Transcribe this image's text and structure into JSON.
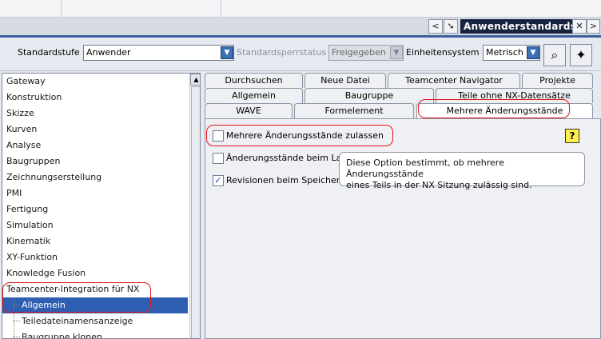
{
  "header": {
    "title": "Anwenderstandards",
    "nav_prev": "<",
    "nav_next": ">"
  },
  "toolbar": {
    "standard_level_label": "Standardstufe",
    "standard_level_value": "Anwender",
    "lock_status_label": "Standardsperrstatus",
    "lock_status_value": "Freigegeben",
    "unit_system_label": "Einheitensystem",
    "unit_system_value": "Metrisch"
  },
  "sidebar": {
    "items": [
      {
        "label": "Gateway"
      },
      {
        "label": "Konstruktion"
      },
      {
        "label": "Skizze"
      },
      {
        "label": "Kurven"
      },
      {
        "label": "Analyse"
      },
      {
        "label": "Baugruppen"
      },
      {
        "label": "Zeichnungserstellung"
      },
      {
        "label": "PMI"
      },
      {
        "label": "Fertigung"
      },
      {
        "label": "Simulation"
      },
      {
        "label": "Kinematik"
      },
      {
        "label": "XY-Funktion"
      },
      {
        "label": "Knowledge Fusion"
      },
      {
        "label": "Teamcenter-Integration für NX"
      },
      {
        "label": "Allgemein"
      },
      {
        "label": "Teiledateinamensanzeige"
      },
      {
        "label": "Baugruppe klonen"
      }
    ]
  },
  "tabs": {
    "row1": [
      "Durchsuchen",
      "Neue Datei",
      "Teamcenter Navigator",
      "Projekte"
    ],
    "row2": [
      "Allgemein",
      "Baugruppe",
      "Teile ohne NX-Datensätze"
    ],
    "row3": [
      "WAVE",
      "Formelement",
      "Mehrere Änderungsstände"
    ]
  },
  "options": [
    {
      "label": "Mehrere Änderungsstände zulassen",
      "checked": false
    },
    {
      "label": "Änderungsstände beim La",
      "checked": false
    },
    {
      "label": "Revisionen beim Speicher",
      "checked": true
    }
  ],
  "help_icon": "?",
  "tooltip": {
    "line1": "Diese Option bestimmt, ob mehrere Änderungsstände",
    "line2": "eines Teils in der NX Sitzung zulässig sind."
  },
  "colors": {
    "accent": "#3b6fb6",
    "selection": "#2f5fb3",
    "title_bg": "#17243f",
    "highlight_red": "#e0161b"
  }
}
